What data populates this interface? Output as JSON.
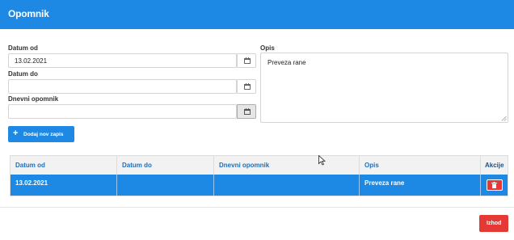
{
  "header": {
    "title": "Opomnik"
  },
  "form": {
    "date_from": {
      "label": "Datum od",
      "value": "13.02.2021",
      "icon": "calendar-icon"
    },
    "date_to": {
      "label": "Datum do",
      "value": "",
      "icon": "calendar-icon"
    },
    "daily_reminder": {
      "label": "Dnevni opomnik",
      "value": "",
      "icon": "calendar-icon"
    },
    "description": {
      "label": "Opis",
      "value": "Preveza rane"
    },
    "add_button": {
      "label": "Dodaj nov zapis",
      "icon": "plus-icon"
    }
  },
  "table": {
    "columns": [
      "Datum od",
      "Datum do",
      "Dnevni opomnik",
      "Opis",
      "Akcije"
    ],
    "rows": [
      {
        "date_from": "13.02.2021",
        "date_to": "",
        "daily_reminder": "",
        "description": "Preveza rane",
        "action_icon": "trash-icon"
      }
    ]
  },
  "footer": {
    "close_label": "Izhod"
  },
  "colors": {
    "primary": "#1e88e5",
    "danger": "#e53935"
  }
}
